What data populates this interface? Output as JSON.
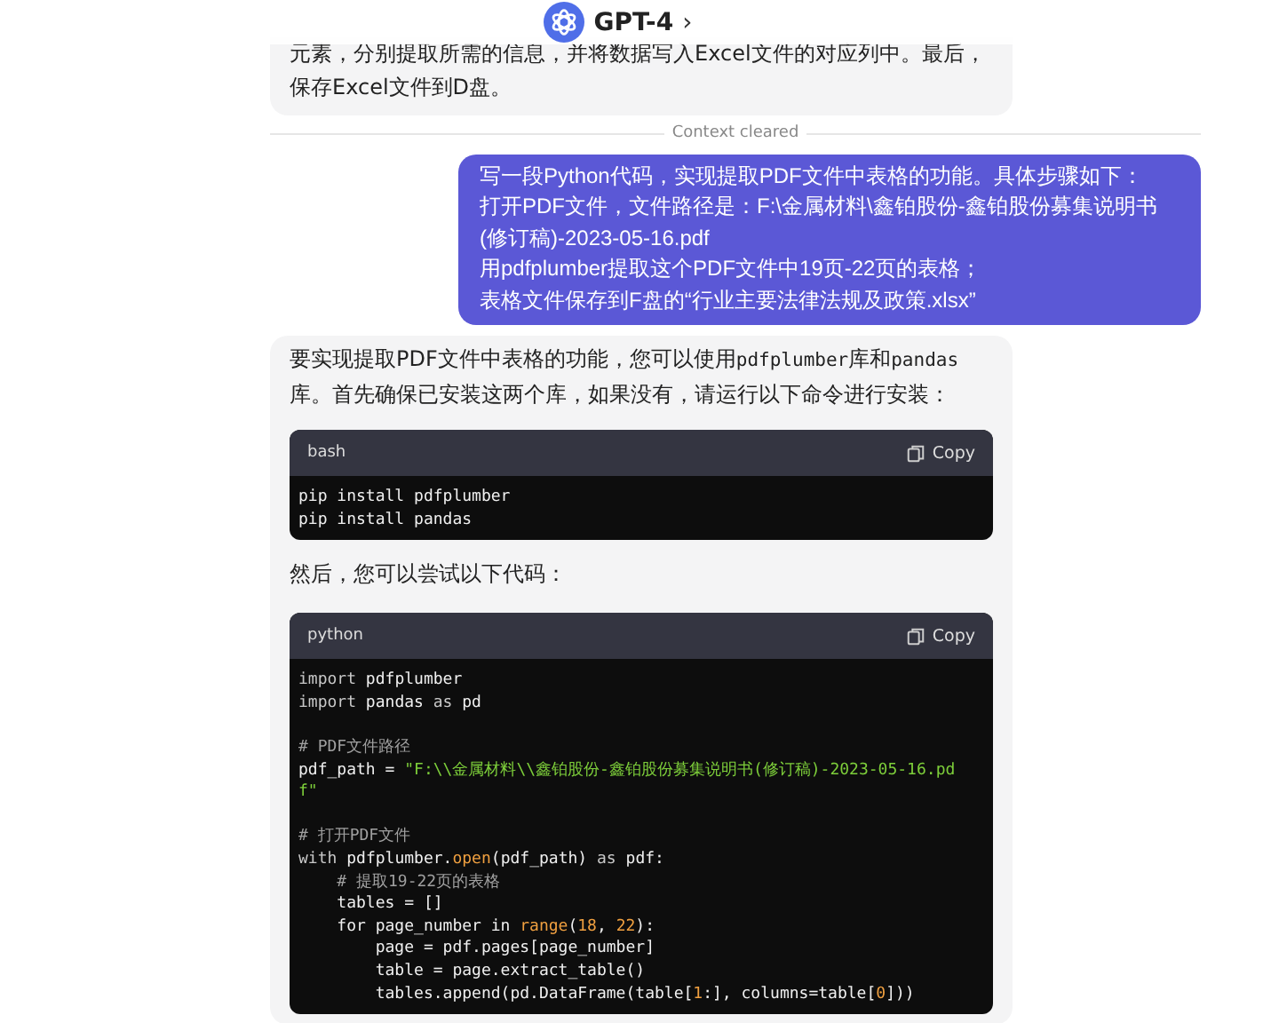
{
  "header": {
    "title": "GPT-4",
    "chevron": "›"
  },
  "messages": [
    {
      "kind": "assistant",
      "blocks": [
        {
          "kind": "text",
          "segments": [
            {
              "text": "元素，分别提取所需的信息，并将数据写入Excel文件的对应列中。最后，保存Excel文件到D盘。",
              "code": false
            }
          ]
        }
      ]
    },
    {
      "kind": "divider",
      "text": "Context cleared"
    },
    {
      "kind": "user",
      "lines": [
        "写一段Python代码，实现提取PDF文件中表格的功能。具体步骤如下：",
        "打开PDF文件，文件路径是：F:\\金属材料\\鑫铂股份-鑫铂股份募集说明书(修订稿)-2023-05-16.pdf",
        "用pdfplumber提取这个PDF文件中19页-22页的表格；",
        "表格文件保存到F盘的“行业主要法律法规及政策.xlsx”"
      ]
    },
    {
      "kind": "assistant",
      "blocks": [
        {
          "kind": "text",
          "segments": [
            {
              "text": "要实现提取PDF文件中表格的功能，您可以使用",
              "code": false
            },
            {
              "text": "pdfplumber",
              "code": true
            },
            {
              "text": "库和",
              "code": false
            },
            {
              "text": "pandas",
              "code": true
            },
            {
              "text": "库。首先确保已安装这两个库，如果没有，请运行以下命令进行安装：",
              "code": false
            }
          ]
        },
        {
          "kind": "code",
          "language": "bash",
          "copy": "Copy",
          "lines": [
            {
              "kind": "code",
              "tokens": [
                {
                  "text": "pip install pdfplumber",
                  "kind": "plain"
                }
              ]
            },
            {
              "kind": "code",
              "tokens": [
                {
                  "text": "pip install pandas",
                  "kind": "plain"
                }
              ]
            }
          ]
        },
        {
          "kind": "text",
          "segments": [
            {
              "text": "然后，您可以尝试以下代码：",
              "code": false
            }
          ]
        },
        {
          "kind": "code",
          "language": "python",
          "copy": "Copy",
          "lines": [
            {
              "kind": "code",
              "tokens": [
                {
                  "text": "import",
                  "kind": "kw"
                },
                {
                  "text": " pdfplumber",
                  "kind": "plain"
                }
              ]
            },
            {
              "kind": "code",
              "tokens": [
                {
                  "text": "import",
                  "kind": "kw"
                },
                {
                  "text": " pandas ",
                  "kind": "plain"
                },
                {
                  "text": "as",
                  "kind": "kw"
                },
                {
                  "text": " pd",
                  "kind": "plain"
                }
              ]
            },
            {
              "kind": "blank"
            },
            {
              "kind": "code",
              "tokens": [
                {
                  "text": "# PDF文件路径",
                  "kind": "cm"
                }
              ]
            },
            {
              "kind": "code",
              "tokens": [
                {
                  "text": "pdf_path = ",
                  "kind": "plain"
                },
                {
                  "text": "\"F:\\\\金属材料\\\\鑫铂股份-鑫铂股份募集说明书(修订稿)-2023-05-16.pd",
                  "kind": "str"
                }
              ]
            },
            {
              "kind": "code",
              "tokens": [
                {
                  "text": "f\"",
                  "kind": "str"
                }
              ]
            },
            {
              "kind": "blank"
            },
            {
              "kind": "code",
              "tokens": [
                {
                  "text": "# 打开PDF文件",
                  "kind": "cm"
                }
              ]
            },
            {
              "kind": "code",
              "tokens": [
                {
                  "text": "with",
                  "kind": "kw"
                },
                {
                  "text": " pdfplumber.",
                  "kind": "plain"
                },
                {
                  "text": "open",
                  "kind": "fn"
                },
                {
                  "text": "(pdf_path) ",
                  "kind": "plain"
                },
                {
                  "text": "as",
                  "kind": "kw"
                },
                {
                  "text": " pdf:",
                  "kind": "plain"
                }
              ]
            },
            {
              "kind": "code",
              "tokens": [
                {
                  "text": "    # 提取19-22页的表格",
                  "kind": "cm"
                }
              ]
            },
            {
              "kind": "code",
              "tokens": [
                {
                  "text": "    tables = []",
                  "kind": "plain"
                }
              ]
            },
            {
              "kind": "code",
              "tokens": [
                {
                  "text": "    for page_number in ",
                  "kind": "plain"
                },
                {
                  "text": "range",
                  "kind": "fn"
                },
                {
                  "text": "(",
                  "kind": "plain"
                },
                {
                  "text": "18",
                  "kind": "num"
                },
                {
                  "text": ", ",
                  "kind": "plain"
                },
                {
                  "text": "22",
                  "kind": "num"
                },
                {
                  "text": "):",
                  "kind": "plain"
                }
              ]
            },
            {
              "kind": "code",
              "tokens": [
                {
                  "text": "        page = pdf.pages[page_number]",
                  "kind": "plain"
                }
              ]
            },
            {
              "kind": "code",
              "tokens": [
                {
                  "text": "        table = page.extract_table()",
                  "kind": "plain"
                }
              ]
            },
            {
              "kind": "code",
              "tokens": [
                {
                  "text": "        tables.append(pd.DataFrame(table[",
                  "kind": "plain"
                },
                {
                  "text": "1",
                  "kind": "num"
                },
                {
                  "text": ":], columns=table[",
                  "kind": "plain"
                },
                {
                  "text": "0",
                  "kind": "num"
                },
                {
                  "text": "]))",
                  "kind": "plain"
                }
              ]
            }
          ]
        }
      ]
    }
  ]
}
